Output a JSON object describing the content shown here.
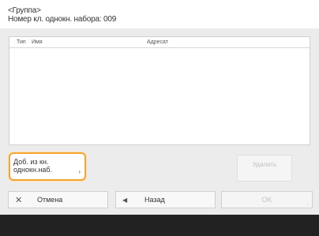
{
  "header": {
    "line1": "<Группа>",
    "line2": "Номер кл. однокн. набора: 009"
  },
  "list": {
    "columns": [
      "Тип",
      "Имя",
      "Адресат"
    ],
    "rows": []
  },
  "buttons": {
    "add_line1": "Доб. из кн.",
    "add_line2": "однокн.наб.",
    "delete": "Удалить",
    "cancel": "Отмена",
    "back": "Назад",
    "ok": "OK"
  },
  "icons": {
    "cancel": "close-icon",
    "back": "back-arrow-icon",
    "add_more": "chevron-right-icon",
    "ok_corner": "corner-enter-icon"
  },
  "colors": {
    "highlight": "#f2a535",
    "panel": "#ececec",
    "bottom_bar": "#222222"
  }
}
